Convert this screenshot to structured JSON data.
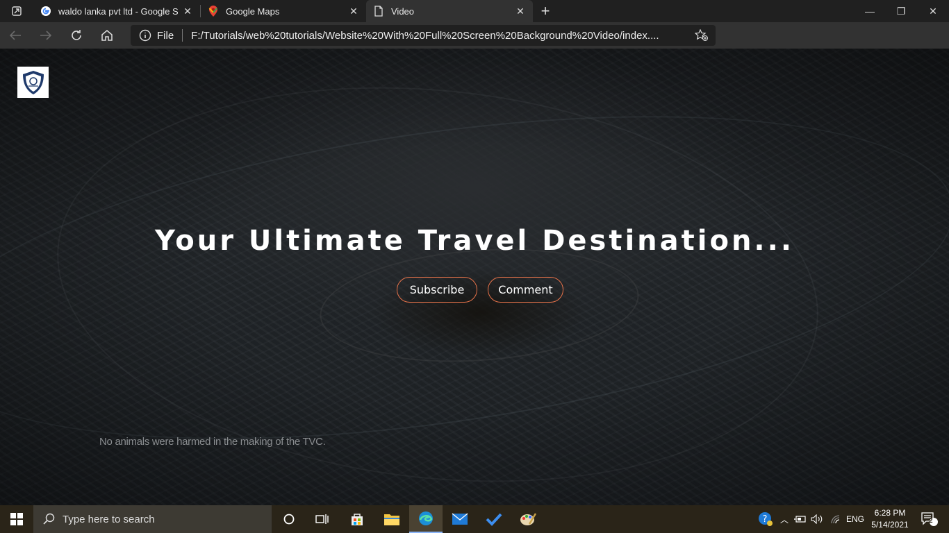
{
  "browser": {
    "tabs": [
      {
        "title": "waldo lanka pvt ltd - Google Sea",
        "icon": "google-icon"
      },
      {
        "title": "Google Maps",
        "icon": "google-maps-icon"
      },
      {
        "title": "Video",
        "icon": "page-icon"
      }
    ],
    "address_scheme": "File",
    "address_url": "F:/Tutorials/web%20tutorials/Website%20With%20Full%20Screen%20Background%20Video/index...."
  },
  "page": {
    "headline": "Your Ultimate Travel Destination...",
    "subscribe_label": "Subscribe",
    "comment_label": "Comment",
    "disclaimer": "No animals were harmed in the making of the TVC.",
    "accent_color": "#e8734a"
  },
  "taskbar": {
    "search_placeholder": "Type here to search",
    "language": "ENG",
    "time": "6:28 PM",
    "date": "5/14/2021",
    "notification_count": "2"
  }
}
